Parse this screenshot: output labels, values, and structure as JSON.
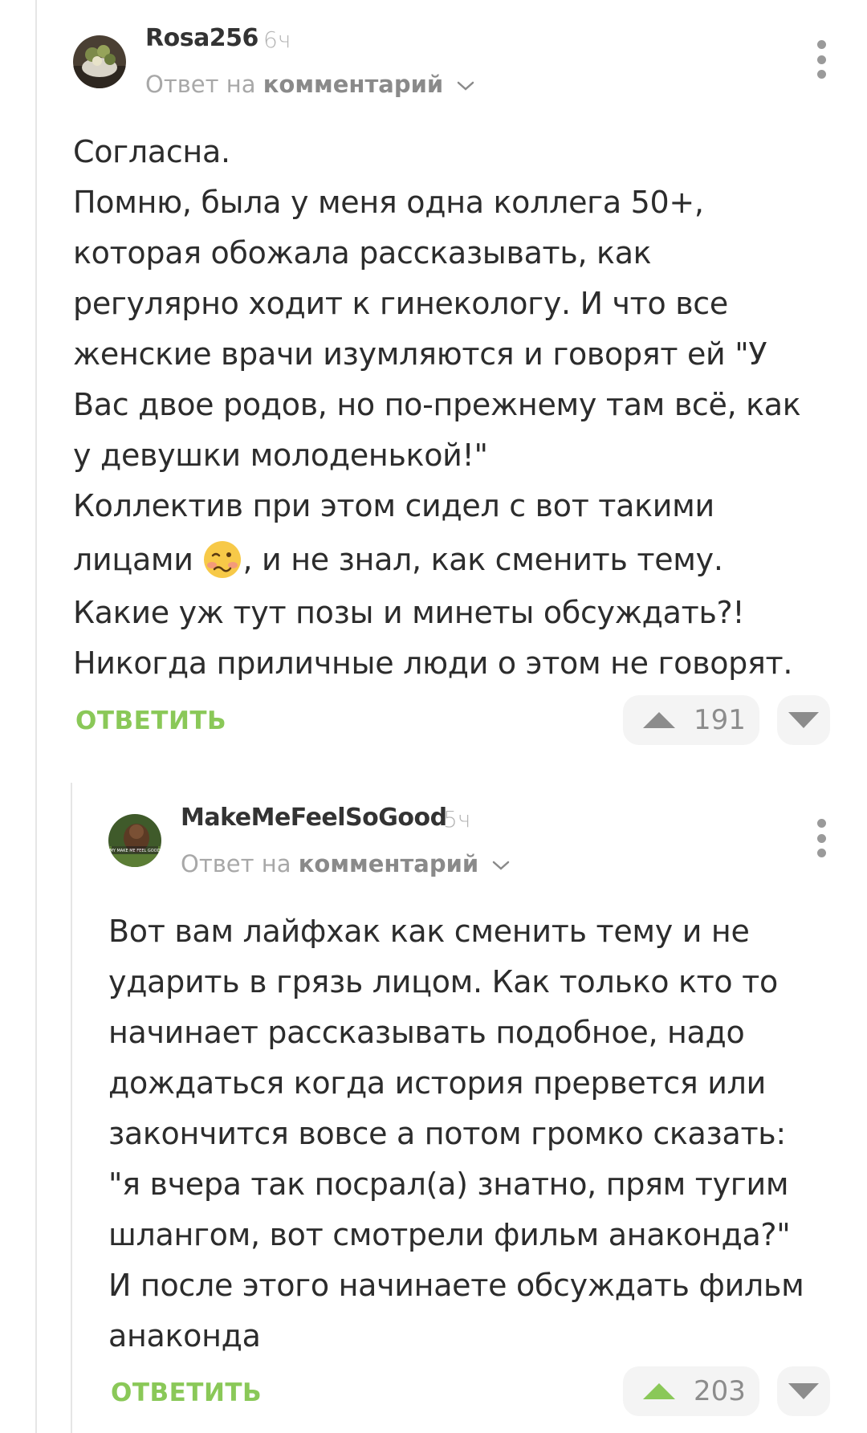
{
  "comments": [
    {
      "username": "Rosa256",
      "time": "6ч",
      "reply_prefix": "Ответ на",
      "reply_link": "комментарий",
      "lines": [
        "Согласна.",
        "Помню, была у меня одна коллега 50+,",
        "которая обожала рассказывать, как",
        "регулярно ходит к гинекологу. И что все",
        "женские врачи изумляются и говорят ей \"У",
        "Вас двое родов, но по-прежнему там всё, как",
        "у девушки молоденькой!\"",
        "Коллектив при этом сидел с вот такими"
      ],
      "line_emoji_before": "лицами",
      "line_emoji_after": ", и не знал, как сменить тему.",
      "lines_after": [
        "Какие уж тут позы и минеты обсуждать?!",
        "Никогда приличные люди о этом не говорят."
      ],
      "reply_label": "ОТВЕТИТЬ",
      "rating": "191",
      "upvoted": false
    },
    {
      "username": "MakeMeFeelSoGood",
      "time": "5ч",
      "reply_prefix": "Ответ на",
      "reply_link": "комментарий",
      "avatar_caption": "MY MAKE ME FEEL GOOD",
      "lines": [
        "Вот вам лайфхак как сменить тему и не",
        "ударить в грязь лицом. Как только кто то",
        "начинает рассказывать подобное, надо",
        "дождаться когда история прервется или",
        "закончится вовсе а потом громко сказать:",
        "\"я вчера так посрал(а) знатно, прям тугим",
        "шлангом, вот смотрели фильм анаконда?\"",
        "И после этого начинаете обсуждать фильм",
        "анаконда"
      ],
      "reply_label": "ОТВЕТИТЬ",
      "rating": "203",
      "upvoted": true
    }
  ],
  "colors": {
    "accent_green": "#8ac858",
    "vote_bg": "#f4f4f4",
    "muted": "#a8a8a8"
  }
}
